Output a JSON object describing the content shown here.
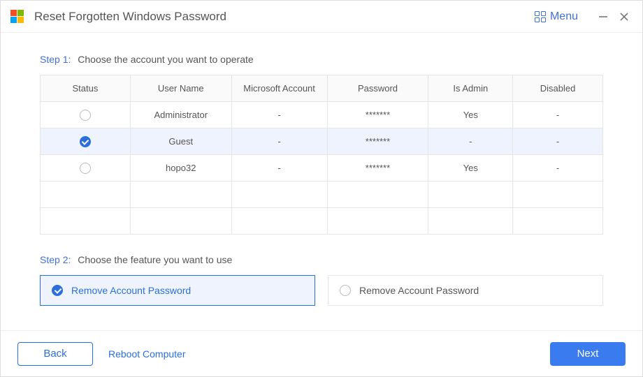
{
  "titlebar": {
    "title": "Reset Forgotten Windows Password",
    "menu_label": "Menu",
    "logo_colors": [
      "#f25022",
      "#7fba00",
      "#00a4ef",
      "#ffb900"
    ]
  },
  "step1": {
    "label": "Step 1:",
    "text": "Choose the account you want to operate"
  },
  "table": {
    "headers": {
      "status": "Status",
      "username": "User Name",
      "ms_account": "Microsoft Account",
      "password": "Password",
      "is_admin": "Is Admin",
      "disabled": "Disabled"
    },
    "rows": [
      {
        "selected": false,
        "username": "Administrator",
        "ms_account": "-",
        "password": "*******",
        "is_admin": "Yes",
        "disabled": "-"
      },
      {
        "selected": true,
        "username": "Guest",
        "ms_account": "-",
        "password": "*******",
        "is_admin": "-",
        "disabled": "-"
      },
      {
        "selected": false,
        "username": "hopo32",
        "ms_account": "-",
        "password": "*******",
        "is_admin": "Yes",
        "disabled": "-"
      }
    ]
  },
  "step2": {
    "label": "Step 2:",
    "text": "Choose the feature you want to use",
    "options": [
      {
        "label": "Remove Account Password",
        "selected": true
      },
      {
        "label": "Remove Account Password",
        "selected": false
      }
    ]
  },
  "footer": {
    "back": "Back",
    "reboot": "Reboot Computer",
    "next": "Next"
  }
}
